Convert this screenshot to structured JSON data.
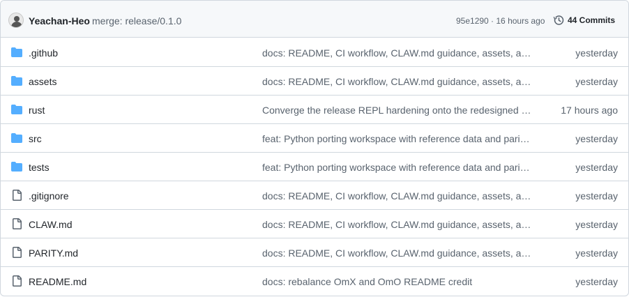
{
  "latest_commit": {
    "author": "Yeachan-Heo",
    "message": "merge: release/0.1.0",
    "sha_time": "95e1290 · 16 hours ago",
    "commits_label": "44 Commits",
    "avatar_icon": "user-avatar",
    "history_icon": "history-icon"
  },
  "files": [
    {
      "type": "folder",
      "icon": "folder-icon",
      "name": ".github",
      "commit": "docs: README, CI workflow, CLAW.md guidance, assets, and …",
      "date": "yesterday"
    },
    {
      "type": "folder",
      "icon": "folder-icon",
      "name": "assets",
      "commit": "docs: README, CI workflow, CLAW.md guidance, assets, and …",
      "date": "yesterday"
    },
    {
      "type": "folder",
      "icon": "folder-icon",
      "name": "rust",
      "commit": "Converge the release REPL hardening onto the redesigned CLI",
      "date": "17 hours ago"
    },
    {
      "type": "folder",
      "icon": "folder-icon",
      "name": "src",
      "commit": "feat: Python porting workspace with reference data and parit…",
      "date": "yesterday"
    },
    {
      "type": "folder",
      "icon": "folder-icon",
      "name": "tests",
      "commit": "feat: Python porting workspace with reference data and parit…",
      "date": "yesterday"
    },
    {
      "type": "file",
      "icon": "file-icon",
      "name": ".gitignore",
      "commit": "docs: README, CI workflow, CLAW.md guidance, assets, and …",
      "date": "yesterday"
    },
    {
      "type": "file",
      "icon": "file-icon",
      "name": "CLAW.md",
      "commit": "docs: README, CI workflow, CLAW.md guidance, assets, and …",
      "date": "yesterday"
    },
    {
      "type": "file",
      "icon": "file-icon",
      "name": "PARITY.md",
      "commit": "docs: README, CI workflow, CLAW.md guidance, assets, and …",
      "date": "yesterday"
    },
    {
      "type": "file",
      "icon": "file-icon",
      "name": "README.md",
      "commit": "docs: rebalance OmX and OmO README credit",
      "date": "yesterday"
    }
  ],
  "colors": {
    "folder": "#54aeff",
    "file_icon": "#59636e",
    "text_primary": "#1f2328",
    "text_muted": "#59636e",
    "border": "#d0d7de",
    "header_bg": "#f6f8fa"
  }
}
